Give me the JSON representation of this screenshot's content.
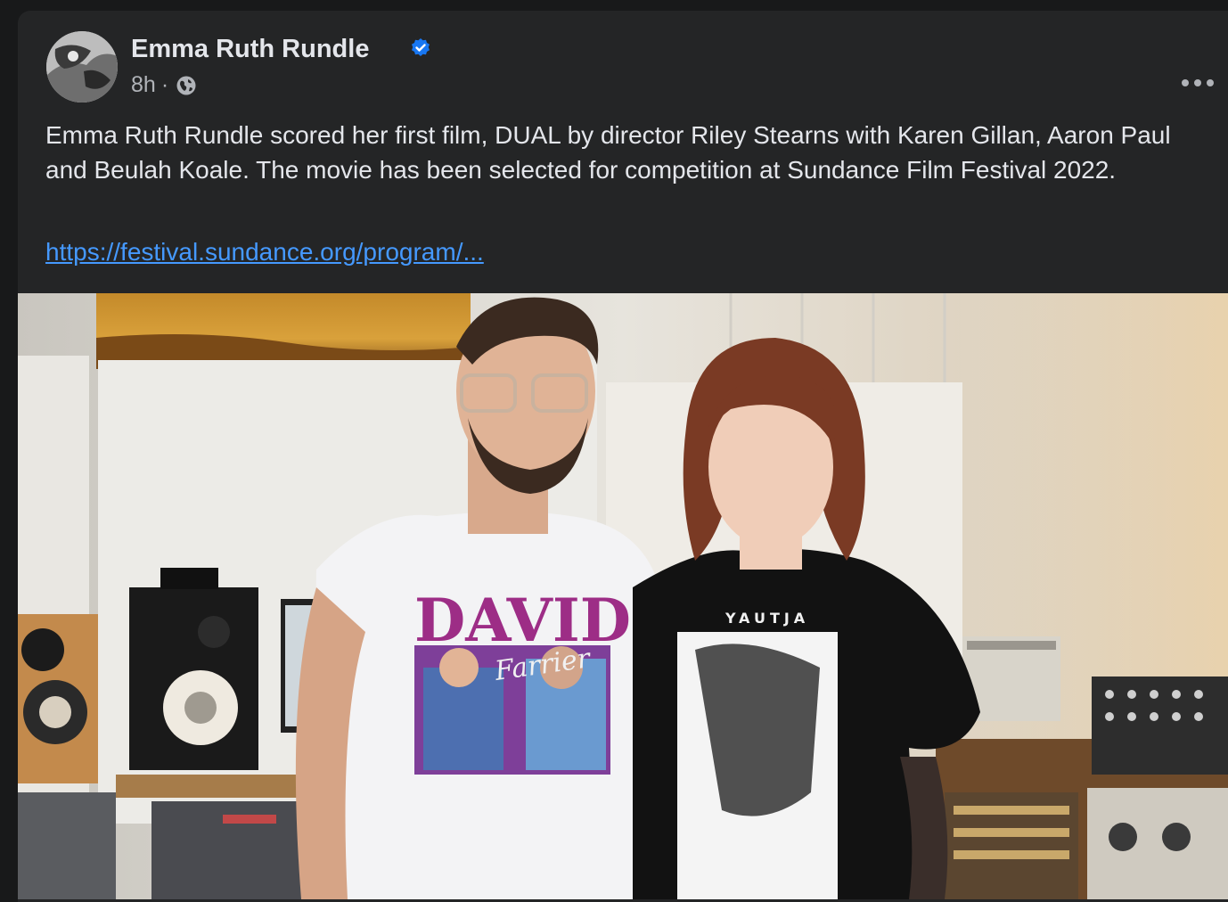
{
  "post": {
    "author": "Emma Ruth Rundle",
    "time": "8h",
    "separator": "·",
    "text": "Emma Ruth Rundle scored her first film, DUAL by director Riley Stearns with Karen Gillan, Aaron Paul and Beulah Koale. The movie has been selected for competition at Sundance Film Festival 2022.",
    "link": "https://festival.sundance.org/program/...",
    "icons": {
      "verified": "verified-badge-icon",
      "audience": "globe-icon",
      "menu": "more-options-icon"
    }
  },
  "photo": {
    "shirt_left_line1": "DAVID",
    "shirt_left_line2": "Farrier",
    "shirt_right": "YAUTJA"
  },
  "colors": {
    "background": "#18191a",
    "card": "#242526",
    "text_primary": "#e4e6eb",
    "text_secondary": "#b0b3b8",
    "link": "#4599ff",
    "verified": "#1877f2"
  }
}
